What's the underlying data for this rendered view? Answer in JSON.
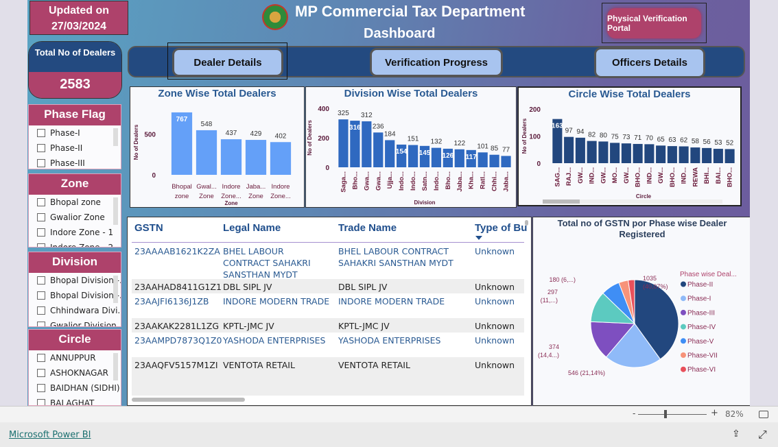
{
  "header": {
    "updated_label": "Updated on",
    "updated_date": "27/03/2024",
    "title": "MP Commercial Tax Department",
    "subtitle": "Dashboard",
    "portal_button": "Physical Verification Portal"
  },
  "kpi": {
    "label": "Total No of Dealers",
    "value": "2583"
  },
  "nav": {
    "tabs": [
      "Dealer Details",
      "Verification Progress",
      "Officers Details"
    ],
    "selected": "Dealer Details"
  },
  "slicers": [
    {
      "title": "Phase Flag",
      "items": [
        "Phase-I",
        "Phase-II",
        "Phase-III"
      ]
    },
    {
      "title": "Zone",
      "items": [
        "Bhopal zone",
        "Gwalior Zone",
        "Indore Zone - 1",
        "Indore Zone - 2"
      ]
    },
    {
      "title": "Division",
      "items": [
        "Bhopal Division -...",
        "Bhopal Division -...",
        "Chhindwara Divi...",
        "Gwalior Division..."
      ]
    },
    {
      "title": "Circle",
      "items": [
        "ANNUPPUR",
        "ASHOKNAGAR",
        "BAIDHAN (SIDHI)",
        "BALAGHAT"
      ]
    }
  ],
  "table": {
    "columns": [
      "GSTN",
      "Legal Name",
      "Trade Name",
      "Type of Bu"
    ],
    "rows": [
      [
        "23AAAAB1621K2ZA",
        "BHEL LABOUR CONTRACT SAHAKRI SANSTHAN MYDT",
        "BHEL LABOUR CONTRACT SAHAKRI SANSTHAN MYDT",
        "Unknown"
      ],
      [
        "23AAHAD8411G1Z1",
        "DBL SIPL JV",
        "DBL SIPL JV",
        "Unknown"
      ],
      [
        "23AAJFI6136J1ZB",
        "INDORE MODERN TRADE",
        "INDORE MODERN TRADE",
        "Unknown"
      ],
      [
        "23AAKAK2281L1ZG",
        "KPTL-JMC JV",
        "KPTL-JMC JV",
        "Unknown"
      ],
      [
        "23AAMPD7873Q1Z0",
        "YASHODA ENTERPRISES",
        "YASHODA ENTERPRISES",
        "Unknown"
      ],
      [
        "23AAQFV5157M1ZI",
        "VENTOTA RETAIL",
        "VENTOTA RETAIL",
        "Unknown"
      ]
    ]
  },
  "chart_data": [
    {
      "type": "bar",
      "title": "Zone Wise Total Dealers",
      "xlabel": "Zone",
      "ylabel": "No of Dealers",
      "ylim": [
        0,
        800
      ],
      "yticks": [
        0,
        500
      ],
      "color": "#64a0f8",
      "categories": [
        "Bhopal zone",
        "Gwal... Zone",
        "Indore Zone...",
        "Jaba... Zone",
        "Indore Zone..."
      ],
      "values": [
        767,
        548,
        437,
        429,
        402
      ]
    },
    {
      "type": "bar",
      "title": "Division Wise Total Dealers",
      "xlabel": "Division",
      "ylabel": "No of Dealers",
      "ylim": [
        0,
        400
      ],
      "yticks": [
        0,
        200,
        400
      ],
      "color": "#2f69c0",
      "categories": [
        "Saga...",
        "Bho...",
        "Gwa...",
        "Gwa...",
        "Ujja...",
        "Indo...",
        "Indo...",
        "Satn...",
        "Indo...",
        "Bho...",
        "Jaba...",
        "Kha...",
        "Ratl...",
        "Chhi...",
        "Jaba..."
      ],
      "values": [
        325,
        316,
        312,
        236,
        184,
        154,
        151,
        145,
        132,
        126,
        122,
        117,
        101,
        85,
        77
      ]
    },
    {
      "type": "bar",
      "title": "Circle Wise Total Dealers",
      "xlabel": "Circle",
      "ylabel": "No of Dealers",
      "ylim": [
        0,
        200
      ],
      "yticks": [
        0,
        100,
        200
      ],
      "color": "#22477e",
      "categories": [
        "SAG...",
        "RAJ...",
        "GW...",
        "IND...",
        "GW...",
        "MO...",
        "GW...",
        "BHO...",
        "IND...",
        "GW...",
        "BHO...",
        "IND...",
        "REWA",
        "BHI...",
        "BAI...",
        "BHO..."
      ],
      "values": [
        163,
        97,
        94,
        82,
        80,
        75,
        73,
        71,
        70,
        65,
        63,
        62,
        58,
        56,
        53,
        52
      ]
    },
    {
      "type": "pie",
      "title": "Total no of GSTN por Phase wise Dealer Registered",
      "legend_title": "Phase wise Deal...",
      "legend_position": "right",
      "slices": [
        {
          "name": "Phase-II",
          "value": 1035,
          "label": "1035 (40,07%)",
          "color": "#22477e"
        },
        {
          "name": "Phase-I",
          "value": 546,
          "label": "546 (21,14%)",
          "color": "#8fbaf8"
        },
        {
          "name": "Phase-III",
          "value": 374,
          "label": "374 (14,4...)",
          "color": "#7e4fc0"
        },
        {
          "name": "Phase-IV",
          "value": 297,
          "label": "297 (11,...)",
          "color": "#5ccac0"
        },
        {
          "name": "Phase-V",
          "value": 180,
          "label": "180 (6,...)",
          "color": "#3f8ef5"
        },
        {
          "name": "Phase-VII",
          "value": 90,
          "label": "",
          "color": "#f7937a"
        },
        {
          "name": "Phase-VI",
          "value": 61,
          "label": "",
          "color": "#e8505b"
        }
      ]
    }
  ],
  "statusbar": {
    "zoom": "82%",
    "zoom_percent": 82
  },
  "footer": {
    "link": "Microsoft Power BI"
  }
}
